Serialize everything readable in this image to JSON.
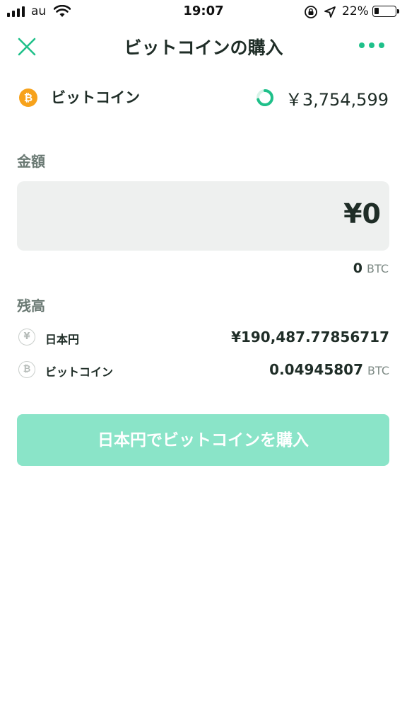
{
  "status_bar": {
    "carrier": "au",
    "time": "19:07",
    "battery_percent": "22%",
    "battery_level": 0.22,
    "icons": [
      "signal-icon",
      "wifi-icon",
      "rotation-lock-icon",
      "location-arrow-icon",
      "battery-icon"
    ]
  },
  "header": {
    "title": "ビットコインの購入",
    "close_icon": "close-icon",
    "more_icon": "more-dots-icon"
  },
  "asset": {
    "name": "ビットコイン",
    "symbol_glyph": "₿",
    "price": "￥3,754,599",
    "spinner_icon": "loading-spinner-icon"
  },
  "amount": {
    "label": "金額",
    "value": "¥0",
    "btc_equivalent": "0",
    "btc_unit": "BTC"
  },
  "balance": {
    "label": "残高",
    "items": [
      {
        "icon_glyph": "¥",
        "name": "日本円",
        "value": "¥190,487.77856717",
        "unit": ""
      },
      {
        "icon_glyph": "₿",
        "name": "ビットコイン",
        "value": "0.04945807",
        "unit": "BTC"
      }
    ]
  },
  "buy_button": {
    "label": "日本円でビットコインを購入"
  },
  "colors": {
    "accent": "#1fc08a",
    "button_disabled": "#8ae4c8",
    "bitcoin_orange": "#f7a21b",
    "input_bg": "#eef0ef",
    "label_gray": "#6b7a74"
  }
}
